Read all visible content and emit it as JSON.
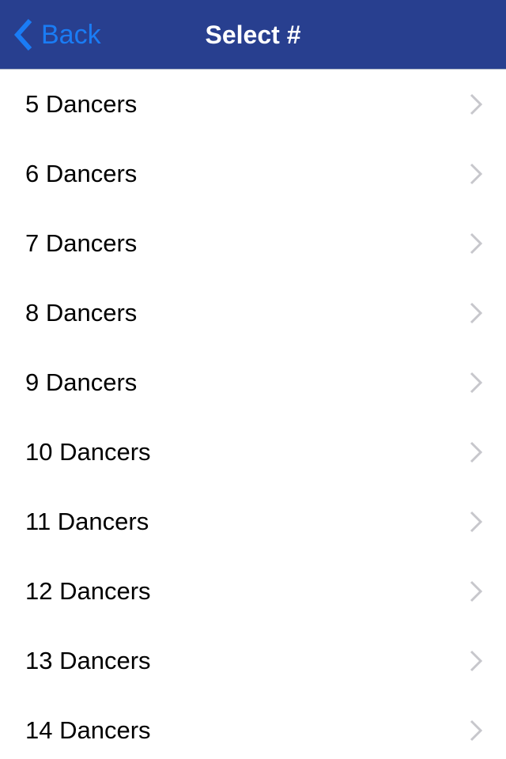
{
  "navbar": {
    "back_label": "Back",
    "back_icon": "chevron-left-icon",
    "title": "Select #",
    "background_color": "#283f8f",
    "back_color": "#1a7cf5"
  },
  "list": {
    "items": [
      {
        "label": "5 Dancers",
        "icon": "chevron-right-icon"
      },
      {
        "label": "6 Dancers",
        "icon": "chevron-right-icon"
      },
      {
        "label": "7 Dancers",
        "icon": "chevron-right-icon"
      },
      {
        "label": "8 Dancers",
        "icon": "chevron-right-icon"
      },
      {
        "label": "9 Dancers",
        "icon": "chevron-right-icon"
      },
      {
        "label": "10 Dancers",
        "icon": "chevron-right-icon"
      },
      {
        "label": "11 Dancers",
        "icon": "chevron-right-icon"
      },
      {
        "label": "12 Dancers",
        "icon": "chevron-right-icon"
      },
      {
        "label": "13 Dancers",
        "icon": "chevron-right-icon"
      },
      {
        "label": "14 Dancers",
        "icon": "chevron-right-icon"
      }
    ],
    "chevron_color": "#c7c7cc"
  }
}
